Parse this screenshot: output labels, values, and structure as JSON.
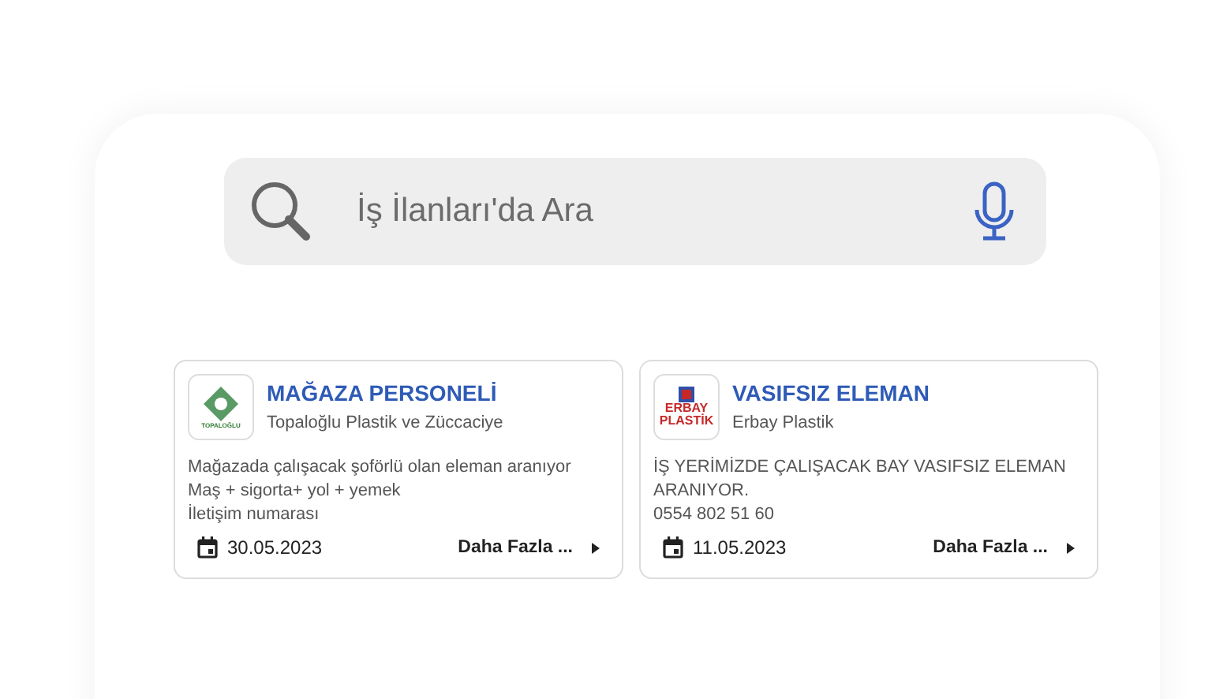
{
  "search": {
    "placeholder": "İş İlanları'da Ara"
  },
  "jobs": [
    {
      "title": "MAĞAZA PERSONELİ",
      "company": "Topaloğlu Plastik ve Züccaciye",
      "kind": "topaloglu",
      "logo_text": "TOPALOĞLU",
      "description": [
        "Mağazada çalışacak şoförlü olan eleman aranıyor",
        "Maş + sigorta+ yol + yemek",
        "İletişim numarası"
      ],
      "date": "30.05.2023",
      "more": "Daha Fazla ..."
    },
    {
      "title": "VASIFSIZ ELEMAN",
      "company": "Erbay Plastik",
      "kind": "erbay",
      "logo_text": "ERBAY PLASTİK",
      "description": [
        "İŞ YERİMİZDE ÇALIŞACAK BAY VASIFSIZ ELEMAN ARANIYOR.",
        "0554 802 51 60"
      ],
      "date": "11.05.2023",
      "more": "Daha Fazla ..."
    }
  ]
}
